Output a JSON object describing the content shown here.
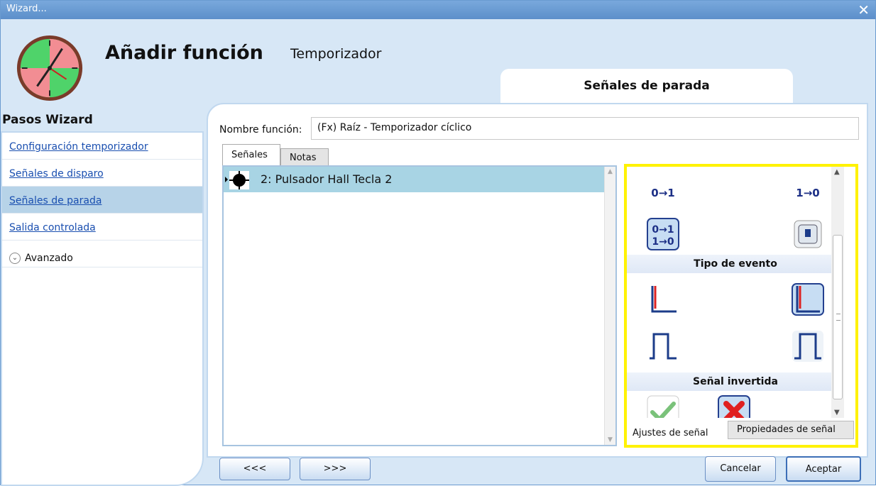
{
  "window": {
    "title": "Wizard...",
    "close_glyph": "✕"
  },
  "header": {
    "title": "Añadir función",
    "subtitle": "Temporizador",
    "current_step": "Señales de parada"
  },
  "sidebar": {
    "heading": "Pasos Wizard",
    "items": [
      {
        "label": "Configuración temporizador",
        "active": false
      },
      {
        "label": "Señales de disparo",
        "active": false
      },
      {
        "label": "Señales de parada",
        "active": true
      },
      {
        "label": "Salida controlada",
        "active": false
      }
    ],
    "advanced_label": "Avanzado"
  },
  "form": {
    "name_label": "Nombre función:",
    "name_value": "(Fx) Raíz - Temporizador cíclico"
  },
  "tabs": [
    {
      "label": "Señales",
      "selected": true
    },
    {
      "label": "Notas",
      "selected": false
    }
  ],
  "signals": [
    {
      "label": "2: Pulsador Hall Tecla 2",
      "icon": "pushbutton-icon",
      "selected": true
    }
  ],
  "settings": {
    "transitions": [
      {
        "label": "0→1",
        "icon": "rising-transition-icon"
      },
      {
        "label": "1→0",
        "icon": "falling-transition-icon"
      },
      {
        "label": "0→1 1→0",
        "icon": "both-transitions-icon"
      },
      {
        "label": "",
        "icon": "button-press-icon"
      }
    ],
    "event_type_title": "Tipo de evento",
    "event_types": [
      {
        "icon": "edge-event-icon"
      },
      {
        "icon": "edge-event-selected-icon"
      },
      {
        "icon": "pulse-event-icon"
      },
      {
        "icon": "pulse-event-selected-icon"
      }
    ],
    "inverted_title": "Señal invertida",
    "inverted": [
      {
        "icon": "check-icon"
      },
      {
        "icon": "cross-icon"
      }
    ],
    "tabs": [
      "Ajustes de señal",
      "Propiedades de señal"
    ],
    "highlight_color": "#fff200"
  },
  "buttons": {
    "prev": "<<<",
    "next": ">>>",
    "cancel": "Cancelar",
    "ok": "Aceptar"
  }
}
